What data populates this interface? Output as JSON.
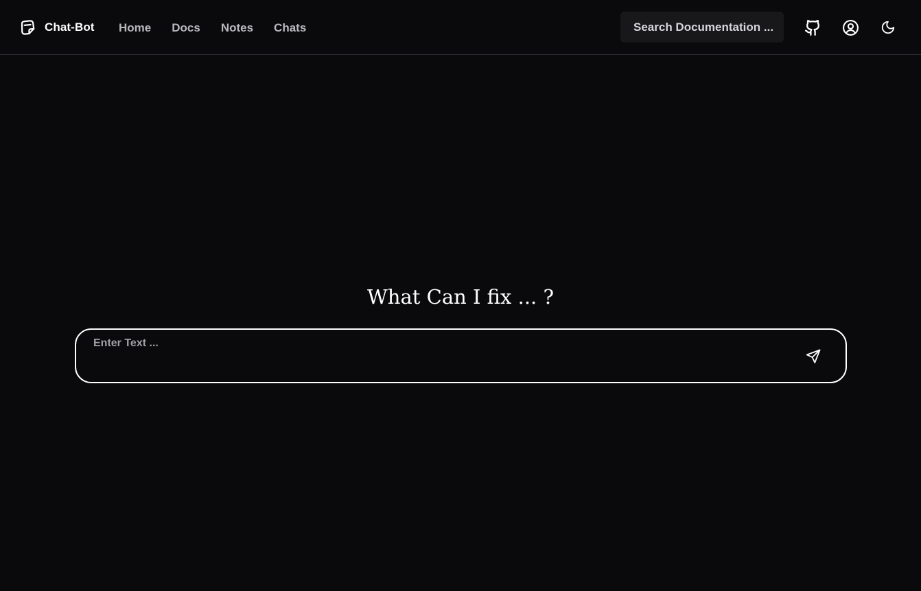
{
  "brand": {
    "name": "Chat-Bot",
    "icon": "sticker-icon"
  },
  "nav": {
    "home": "Home",
    "docs": "Docs",
    "notes": "Notes",
    "chats": "Chats"
  },
  "search": {
    "label": "Search Documentation ..."
  },
  "header_icons": {
    "github": "github-icon",
    "user": "user-circle-icon",
    "theme": "moon-icon"
  },
  "main": {
    "title": "What Can I fix ... ?",
    "input_placeholder": "Enter Text ...",
    "input_value": "",
    "send_icon": "send-icon"
  },
  "colors": {
    "background": "#0a0a0c",
    "text": "#ffffff",
    "muted": "#b8b8bd",
    "search_bg": "#18181b",
    "border": "#2a2a2e"
  }
}
